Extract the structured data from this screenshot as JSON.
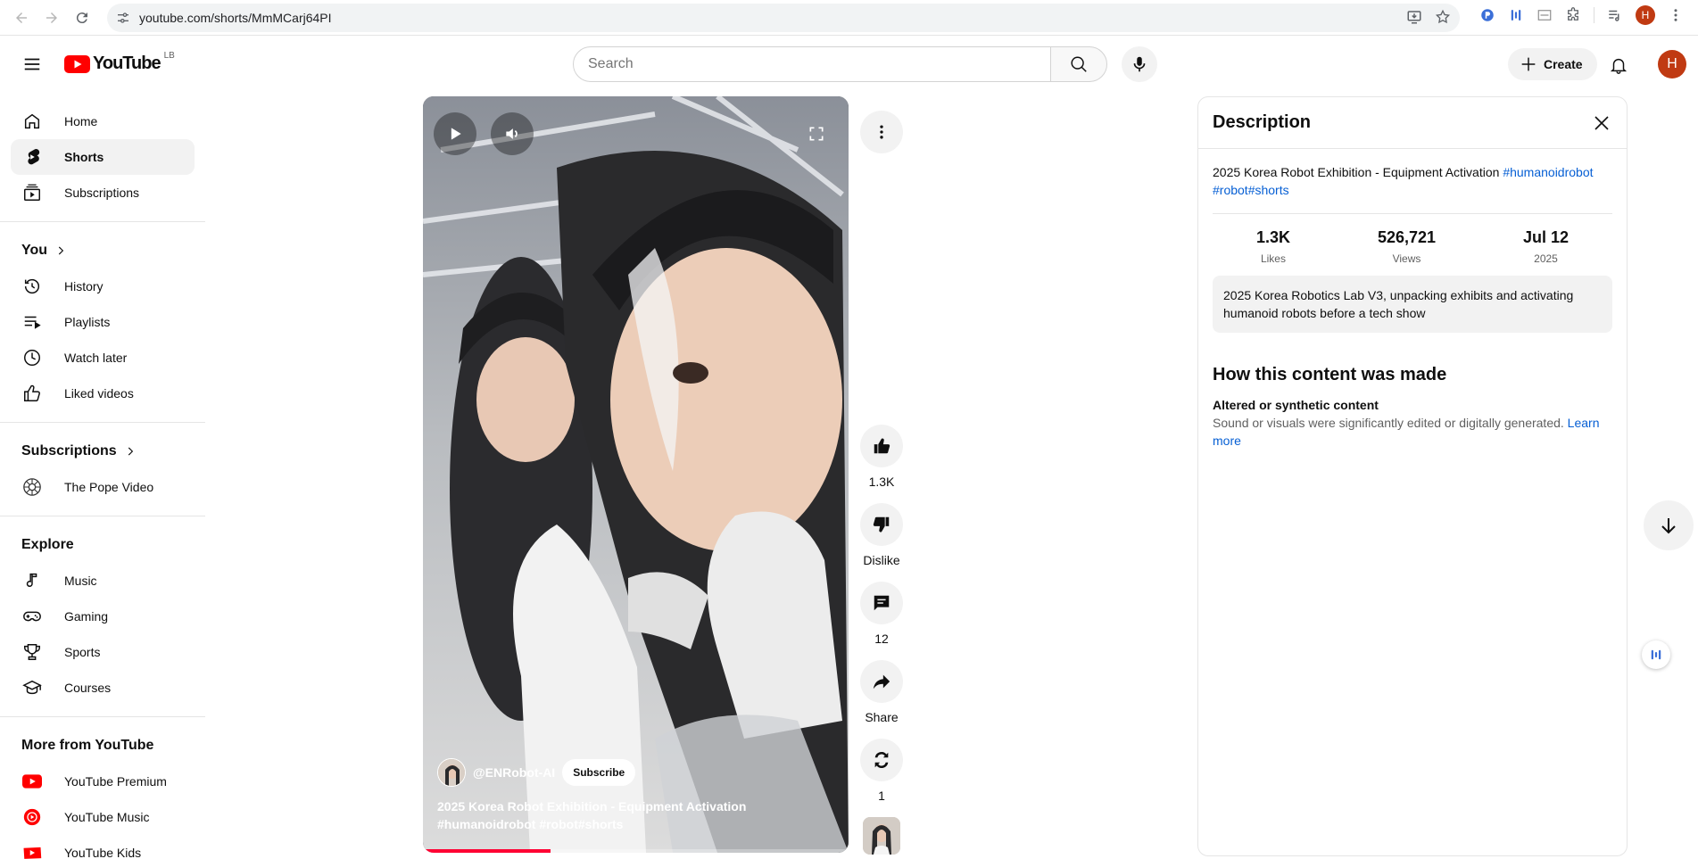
{
  "browser": {
    "url": "youtube.com/shorts/MmMCarj64PI"
  },
  "masthead": {
    "logo_text": "YouTube",
    "country_code": "LB",
    "search_placeholder": "Search",
    "create_label": "Create",
    "avatar_letter": "H"
  },
  "sidebar": {
    "main": [
      {
        "label": "Home",
        "icon": "home-icon"
      },
      {
        "label": "Shorts",
        "icon": "shorts-icon",
        "active": true
      },
      {
        "label": "Subscriptions",
        "icon": "subscriptions-icon"
      }
    ],
    "you_heading": "You",
    "you": [
      {
        "label": "History",
        "icon": "history-icon"
      },
      {
        "label": "Playlists",
        "icon": "playlists-icon"
      },
      {
        "label": "Watch later",
        "icon": "clock-icon"
      },
      {
        "label": "Liked videos",
        "icon": "thumbs-up-icon"
      }
    ],
    "subs_heading": "Subscriptions",
    "subs": [
      {
        "label": "The Pope Video",
        "icon": "channel-avatar"
      }
    ],
    "explore_heading": "Explore",
    "explore": [
      {
        "label": "Music",
        "icon": "music-note-icon"
      },
      {
        "label": "Gaming",
        "icon": "gamepad-icon"
      },
      {
        "label": "Sports",
        "icon": "trophy-icon"
      },
      {
        "label": "Courses",
        "icon": "graduation-cap-icon"
      }
    ],
    "more_heading": "More from YouTube",
    "more": [
      {
        "label": "YouTube Premium",
        "icon": "youtube-premium-icon"
      },
      {
        "label": "YouTube Music",
        "icon": "youtube-music-icon"
      },
      {
        "label": "YouTube Kids",
        "icon": "youtube-kids-icon"
      }
    ]
  },
  "player": {
    "channel": "@ENRobot-AI",
    "subscribe_label": "Subscribe",
    "title": "2025 Korea Robot Exhibition - Equipment Activation",
    "tags": "#humanoidrobot #robot#shorts",
    "progress": 0.3
  },
  "actions": {
    "like_count": "1.3K",
    "dislike_label": "Dislike",
    "comment_count": "12",
    "share_label": "Share",
    "remix_count": "1"
  },
  "description": {
    "heading": "Description",
    "title_text": "2025 Korea Robot Exhibition - Equipment Activation ",
    "title_tags": "#humanoidrobot #robot#shorts",
    "stats": [
      {
        "value": "1.3K",
        "label": "Likes"
      },
      {
        "value": "526,721",
        "label": "Views"
      },
      {
        "value": "Jul 12",
        "label": "2025"
      }
    ],
    "body": "2025 Korea Robotics Lab V3, unpacking exhibits and activating humanoid robots before a tech show",
    "how_heading": "How this content was made",
    "altered_title": "Altered or synthetic content",
    "altered_desc": "Sound or visuals were significantly edited or digitally generated. ",
    "learn_more": "Learn more"
  },
  "colors": {
    "youtube_red": "#ff0000",
    "link_blue": "#065fd4",
    "avatar_bg": "#c03a12"
  }
}
